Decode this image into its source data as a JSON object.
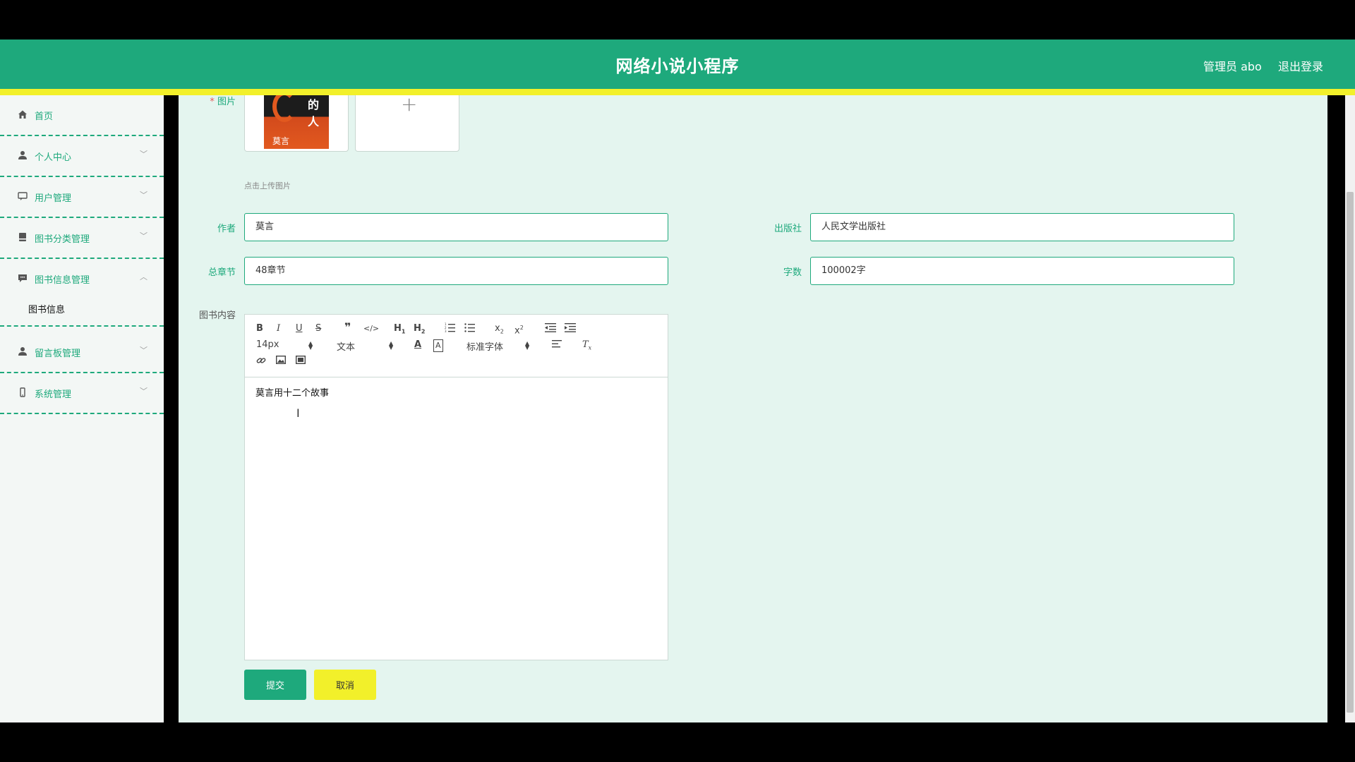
{
  "header": {
    "title": "网络小说小程序",
    "admin_label": "管理员 abo",
    "logout_label": "退出登录"
  },
  "colors": {
    "brand": "#1ea97c",
    "accent": "#f2f02a",
    "content_bg": "#e4f5ef"
  },
  "sidebar": {
    "items": [
      {
        "label": "首页",
        "icon": "home-icon"
      },
      {
        "label": "个人中心",
        "icon": "user-icon"
      },
      {
        "label": "用户管理",
        "icon": "chat-icon"
      },
      {
        "label": "图书分类管理",
        "icon": "book-icon"
      },
      {
        "label": "图书信息管理",
        "icon": "message-icon"
      },
      {
        "label": "留言板管理",
        "icon": "user-icon"
      },
      {
        "label": "系统管理",
        "icon": "phone-icon"
      }
    ],
    "submenu": {
      "label": "图书信息"
    }
  },
  "form": {
    "image": {
      "label": "图片",
      "hint": "点击上传图片",
      "cover_title": "的人",
      "cover_author": "莫言"
    },
    "author": {
      "label": "作者",
      "value": "莫言"
    },
    "publisher": {
      "label": "出版社",
      "value": "人民文学出版社"
    },
    "chapters": {
      "label": "总章节",
      "value": "48章节"
    },
    "word_count": {
      "label": "字数",
      "value": "100002字"
    },
    "content": {
      "label": "图书内容",
      "text": "莫言用十二个故事",
      "font_size": "14px",
      "format": "文本",
      "font_family": "标准字体"
    },
    "submit_label": "提交",
    "cancel_label": "取消"
  }
}
